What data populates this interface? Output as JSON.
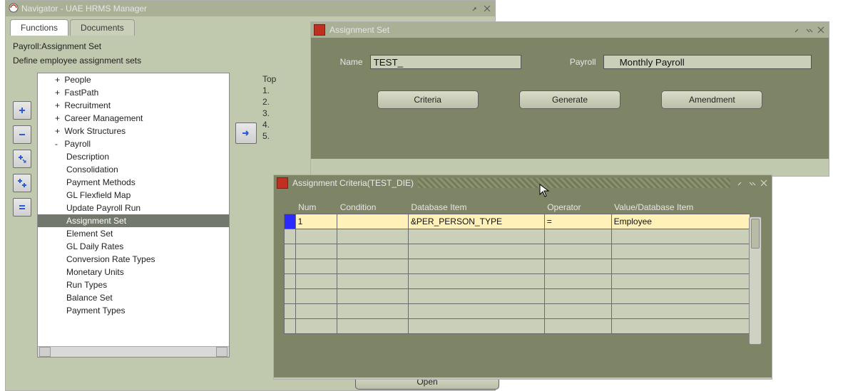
{
  "navigator": {
    "title": "Navigator - UAE HRMS Manager",
    "tabs": {
      "functions": "Functions",
      "documents": "Documents"
    },
    "breadcrumb": "Payroll:Assignment Set",
    "description": "Define employee assignment sets",
    "toolbarIcons": [
      "plus-icon",
      "minus-icon",
      "expand-down-icon",
      "expand-all-icon",
      "collapse-icon"
    ],
    "tree": {
      "roots": [
        {
          "label": "People",
          "toggle": "+"
        },
        {
          "label": "FastPath",
          "toggle": "+"
        },
        {
          "label": "Recruitment",
          "toggle": "+"
        },
        {
          "label": "Career Management",
          "toggle": "+"
        },
        {
          "label": "Work Structures",
          "toggle": "+"
        },
        {
          "label": "Payroll",
          "toggle": "-"
        }
      ],
      "payrollChildren": [
        "Description",
        "Consolidation",
        "Payment Methods",
        "GL Flexfield Map",
        "Update Payroll Run",
        "Assignment Set",
        "Element Set",
        "GL Daily Rates",
        "Conversion Rate Types",
        "Monetary Units",
        "Run Types",
        "Balance Set",
        "Payment Types"
      ],
      "selected": "Assignment Set"
    },
    "topTen": {
      "label": "Top",
      "items": [
        "1.",
        "2.",
        "3.",
        "4.",
        "5."
      ]
    },
    "openLabel": "Open"
  },
  "assignmentSet": {
    "title": "Assignment Set",
    "nameLabel": "Name",
    "nameValue": "TEST_",
    "payrollLabel": "Payroll",
    "payrollValue": "Monthly Payroll",
    "buttons": {
      "criteria": "Criteria",
      "generate": "Generate",
      "amendment": "Amendment"
    }
  },
  "criteria": {
    "title": "Assignment Criteria(TEST_DIE)",
    "columns": {
      "num": "Num",
      "condition": "Condition",
      "db": "Database Item",
      "op": "Operator",
      "val": "Value/Database Item"
    },
    "rows": [
      {
        "num": "1",
        "condition": "",
        "db": "&PER_PERSON_TYPE",
        "op": "=",
        "val": "Employee"
      },
      {
        "num": "",
        "condition": "",
        "db": "",
        "op": "",
        "val": ""
      },
      {
        "num": "",
        "condition": "",
        "db": "",
        "op": "",
        "val": ""
      },
      {
        "num": "",
        "condition": "",
        "db": "",
        "op": "",
        "val": ""
      },
      {
        "num": "",
        "condition": "",
        "db": "",
        "op": "",
        "val": ""
      },
      {
        "num": "",
        "condition": "",
        "db": "",
        "op": "",
        "val": ""
      },
      {
        "num": "",
        "condition": "",
        "db": "",
        "op": "",
        "val": ""
      },
      {
        "num": "",
        "condition": "",
        "db": "",
        "op": "",
        "val": ""
      }
    ]
  }
}
